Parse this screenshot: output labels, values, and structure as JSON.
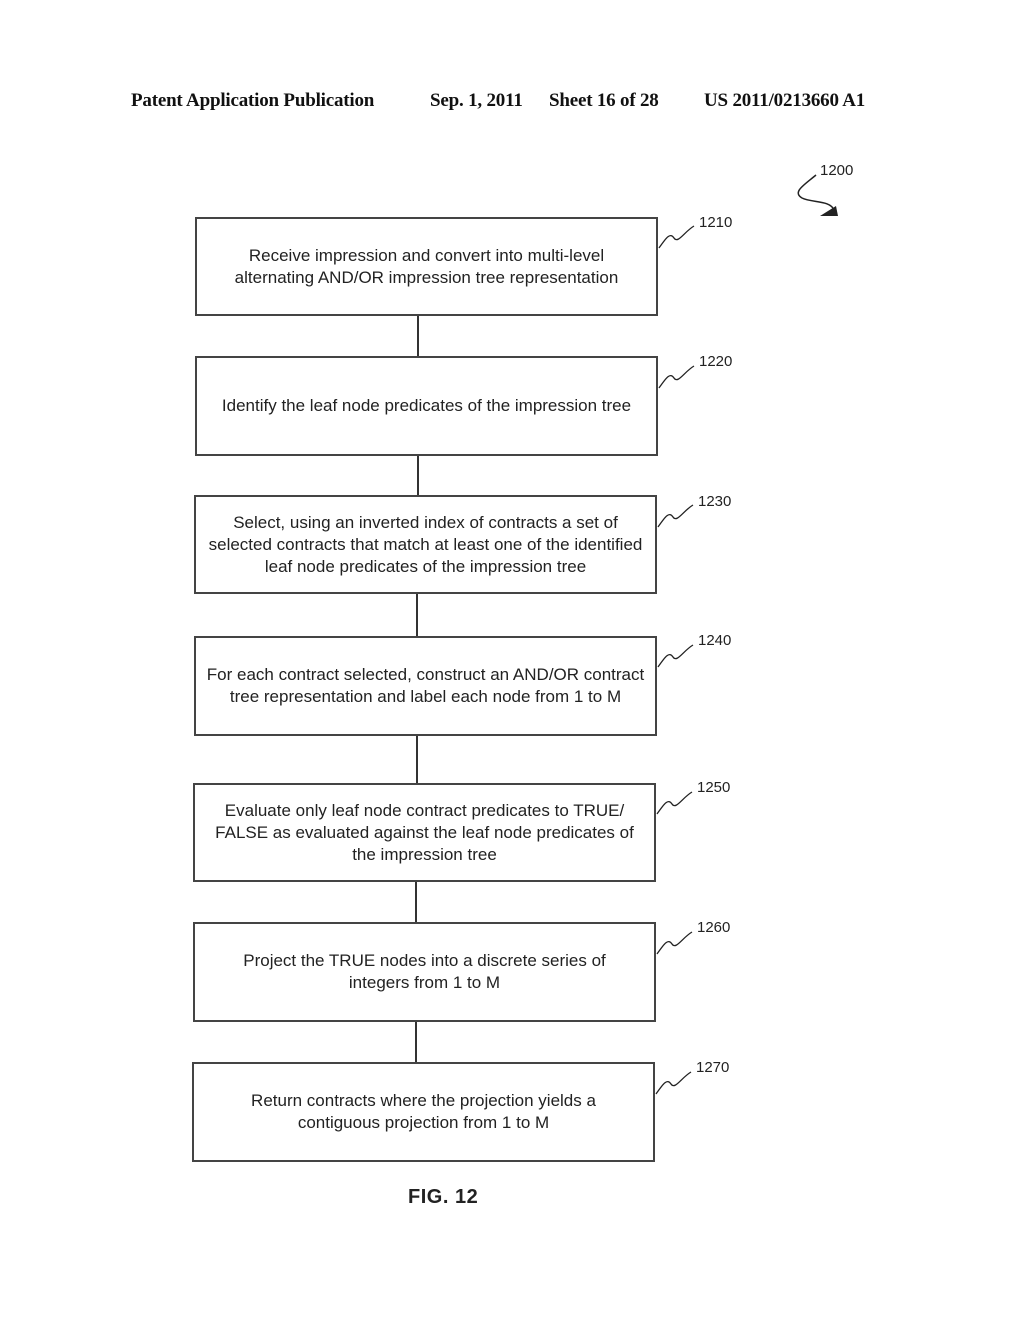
{
  "header": {
    "publication": "Patent Application Publication",
    "date": "Sep. 1, 2011",
    "sheet": "Sheet 16 of 28",
    "number": "US 2011/0213660 A1"
  },
  "figure": {
    "ref": "1200",
    "label": "FIG. 12"
  },
  "steps": [
    {
      "ref": "1210",
      "text": "Receive impression and convert into multi-level alternating AND/OR impression tree representation"
    },
    {
      "ref": "1220",
      "text": "Identify the leaf node predicates of the impression tree"
    },
    {
      "ref": "1230",
      "text": "Select, using an inverted index of contracts a set of selected contracts that match at least one of the identified leaf node predicates of the impression tree"
    },
    {
      "ref": "1240",
      "text": "For each contract selected, construct an AND/OR contract tree representation and label each node from 1 to M"
    },
    {
      "ref": "1250",
      "text": "Evaluate only leaf node contract predicates to TRUE/ FALSE as evaluated against the leaf node predicates of the impression tree"
    },
    {
      "ref": "1260",
      "text": "Project the TRUE nodes into a discrete series of integers from 1 to M"
    },
    {
      "ref": "1270",
      "text": "Return contracts where the projection yields a contiguous projection from 1 to M"
    }
  ]
}
